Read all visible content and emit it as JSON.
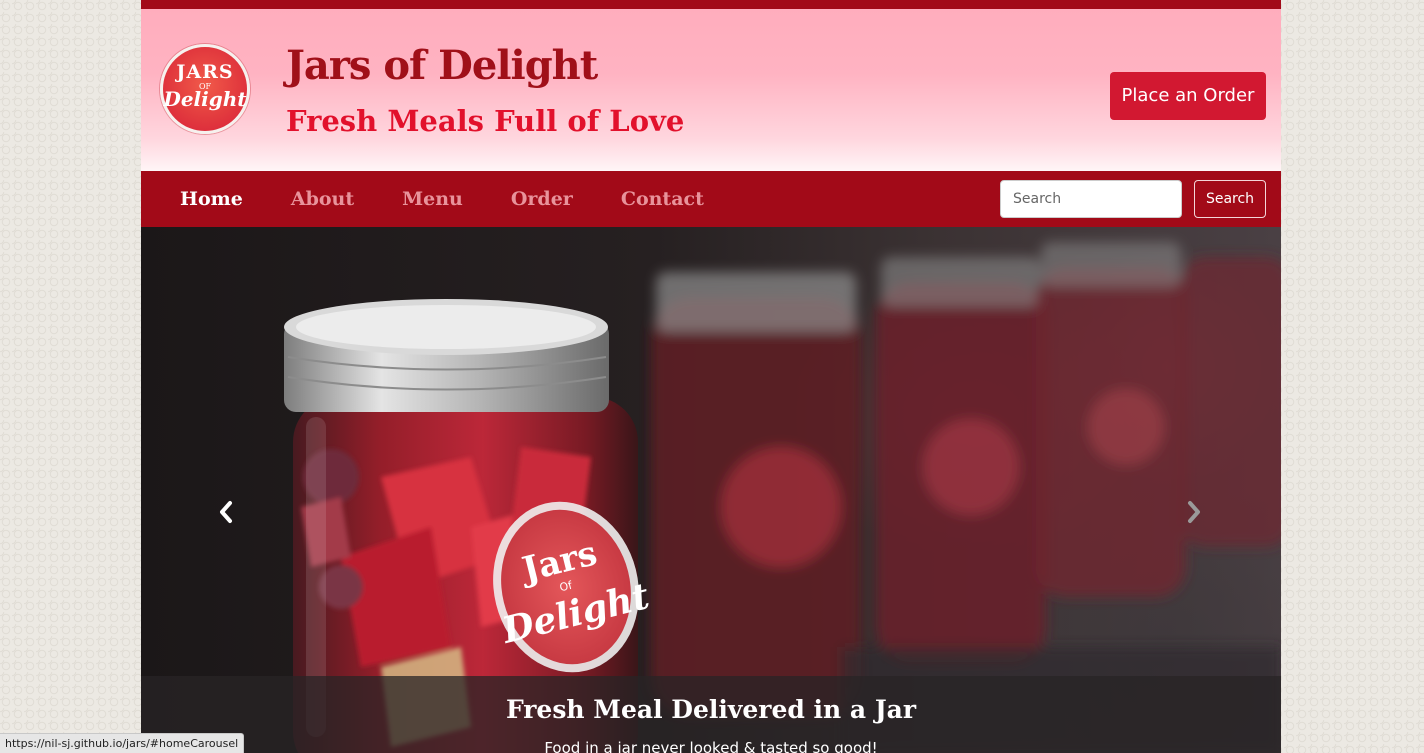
{
  "header": {
    "logo": {
      "line1": "JARS",
      "line2": "OF",
      "line3": "Delight"
    },
    "title": "Jars of Delight",
    "subtitle": "Fresh Meals Full of Love",
    "order_button": "Place an Order"
  },
  "nav": {
    "items": [
      {
        "label": "Home",
        "active": true
      },
      {
        "label": "About",
        "active": false
      },
      {
        "label": "Menu",
        "active": false
      },
      {
        "label": "Order",
        "active": false
      },
      {
        "label": "Contact",
        "active": false
      }
    ],
    "search": {
      "placeholder": "Search",
      "button": "Search"
    }
  },
  "carousel": {
    "prev_icon": "chevron-left-icon",
    "next_icon": "chevron-right-icon",
    "caption_title": "Fresh Meal Delivered in a Jar",
    "caption_text": "Food in a jar never looked & tasted so good!",
    "jar_label": {
      "line1": "Jars",
      "line2": "Of",
      "line3": "Delight"
    }
  },
  "status_bar": {
    "url": "https://nil-sj.github.io/jars/#homeCarousel"
  },
  "colors": {
    "brand_dark_red": "#a20a18",
    "brand_red": "#e2112c",
    "button_red": "#d21831",
    "header_pink": "#ffb3c2"
  }
}
